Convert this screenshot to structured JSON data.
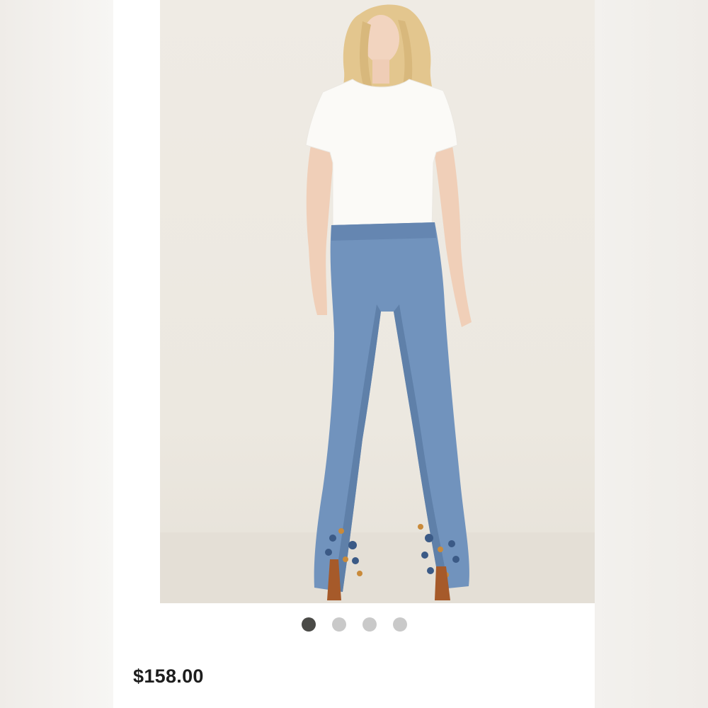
{
  "listing": {
    "price": "$158.00",
    "carousel": {
      "total_images": 4,
      "active_index": 0
    },
    "image_description_icon": "product-photo-icon"
  },
  "colors": {
    "card_background": "#ffffff",
    "active_dot": "#4a4a47",
    "inactive_dot": "#c9c9c9",
    "price_text": "#1d1d1d",
    "denim": "#6f93bf"
  }
}
